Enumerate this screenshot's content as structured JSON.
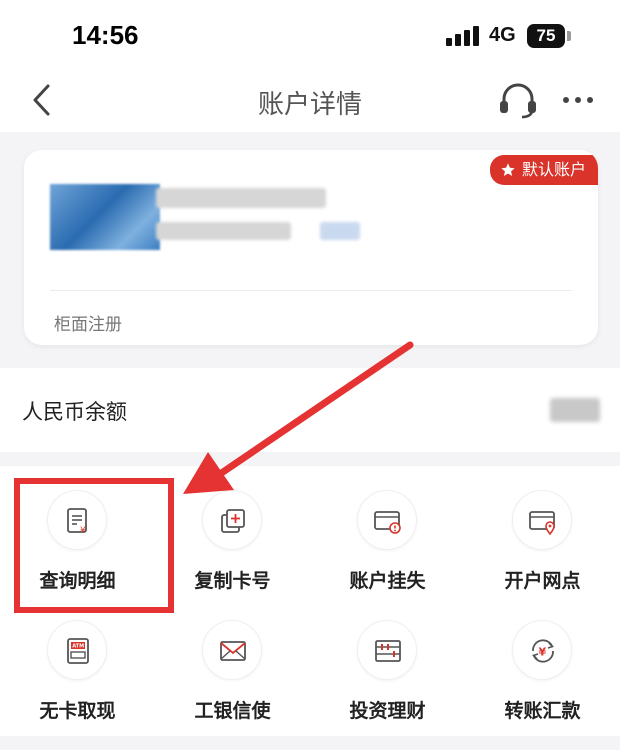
{
  "status_bar": {
    "time": "14:56",
    "network": "4G",
    "battery": "75"
  },
  "nav": {
    "title": "账户详情"
  },
  "account_card": {
    "badge": "默认账户",
    "footer": "柜面注册"
  },
  "balance": {
    "label": "人民币余额"
  },
  "services": [
    {
      "label": "查询明细",
      "icon": "statement-icon"
    },
    {
      "label": "复制卡号",
      "icon": "copy-card-icon"
    },
    {
      "label": "账户挂失",
      "icon": "report-loss-icon"
    },
    {
      "label": "开户网点",
      "icon": "branch-location-icon"
    },
    {
      "label": "无卡取现",
      "icon": "atm-icon"
    },
    {
      "label": "工银信使",
      "icon": "envelope-icon"
    },
    {
      "label": "投资理财",
      "icon": "abacus-icon"
    },
    {
      "label": "转账汇款",
      "icon": "transfer-icon"
    }
  ],
  "colors": {
    "accent": "#d9332a",
    "highlight": "#e53333"
  }
}
